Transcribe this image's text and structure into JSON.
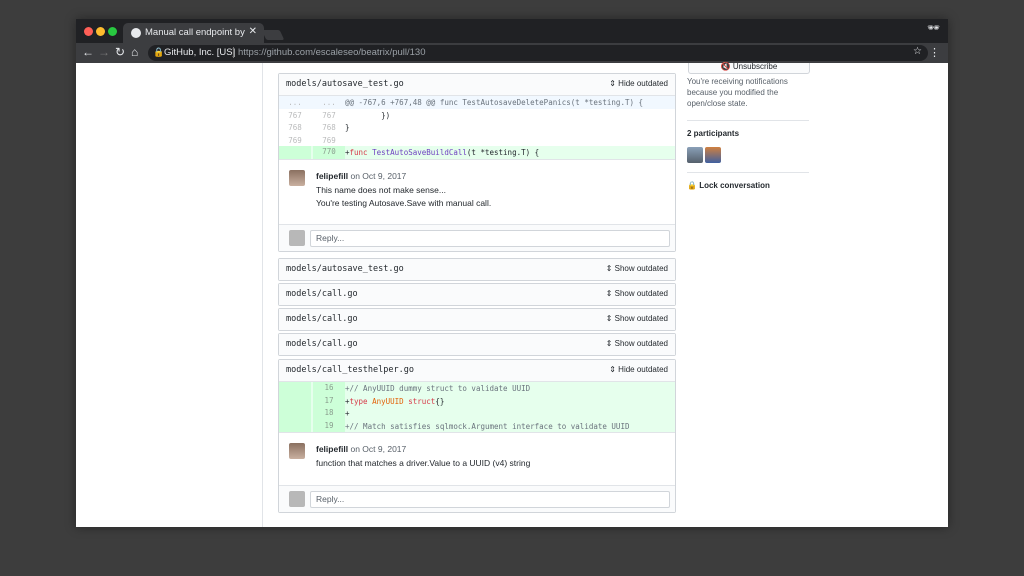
{
  "browser": {
    "tab_title": "Manual call endpoint by rfipa…",
    "tab_close": "✕",
    "org": "GitHub, Inc. [US]",
    "url": "https://github.com/escaleseo/beatrix/pull/130"
  },
  "colors": {
    "red": "#ff5f57",
    "yellow": "#febc2e",
    "green": "#28c840"
  },
  "files": [
    {
      "name": "models/autosave_test.go",
      "toggle": "Hide outdated",
      "diff": [
        {
          "n1": "...",
          "n2": "...",
          "code": "@@ -767,6 +767,48 @@ func TestAutosaveDeletePanics(t *testing.T) {",
          "type": "hunk"
        },
        {
          "n1": "767",
          "n2": "767",
          "code": "        })",
          "type": "ctx"
        },
        {
          "n1": "768",
          "n2": "768",
          "code": "}",
          "type": "ctx"
        },
        {
          "n1": "769",
          "n2": "769",
          "code": "",
          "type": "ctx"
        },
        {
          "n1": "",
          "n2": "770",
          "code_pre": "+",
          "code_kw": "func",
          "code_fn": " TestAutoSaveBuildCall",
          "code_post": "(t *testing.T) {",
          "type": "add"
        }
      ],
      "comment": {
        "author": "felipefill",
        "date": " on Oct 9, 2017",
        "lines": [
          "This name does not make sense...",
          "You're testing Autosave.Save with manual call."
        ]
      },
      "reply_placeholder": "Reply..."
    },
    {
      "name": "models/autosave_test.go",
      "toggle": "Show outdated"
    },
    {
      "name": "models/call.go",
      "toggle": "Show outdated"
    },
    {
      "name": "models/call.go",
      "toggle": "Show outdated"
    },
    {
      "name": "models/call.go",
      "toggle": "Show outdated"
    },
    {
      "name": "models/call_testhelper.go",
      "toggle": "Hide outdated",
      "diff": [
        {
          "n1": "",
          "n2": "16",
          "code": "+// AnyUUID dummy struct to validate UUID",
          "type": "add"
        },
        {
          "n1": "",
          "n2": "17",
          "code_pre": "+",
          "code_kw": "type",
          "code_fn": " AnyUUID",
          "code_kw2": " struct",
          "code_post": "{}",
          "type": "add"
        },
        {
          "n1": "",
          "n2": "18",
          "code": "+",
          "type": "add"
        },
        {
          "n1": "",
          "n2": "19",
          "code": "+// Match satisfies sqlmock.Argument interface to validate UUID",
          "type": "add"
        }
      ],
      "comment": {
        "author": "felipefill",
        "date": " on Oct 9, 2017",
        "lines": [
          "function that matches a driver.Value to a UUID (v4) string"
        ]
      },
      "reply_placeholder": "Reply..."
    }
  ],
  "sidebar": {
    "unsubscribe": "🔇 Unsubscribe",
    "notif_line1": "You're receiving notifications",
    "notif_line2": "because you modified the",
    "notif_line3": "open/close state.",
    "participants": "2 participants",
    "lock": "Lock conversation"
  }
}
